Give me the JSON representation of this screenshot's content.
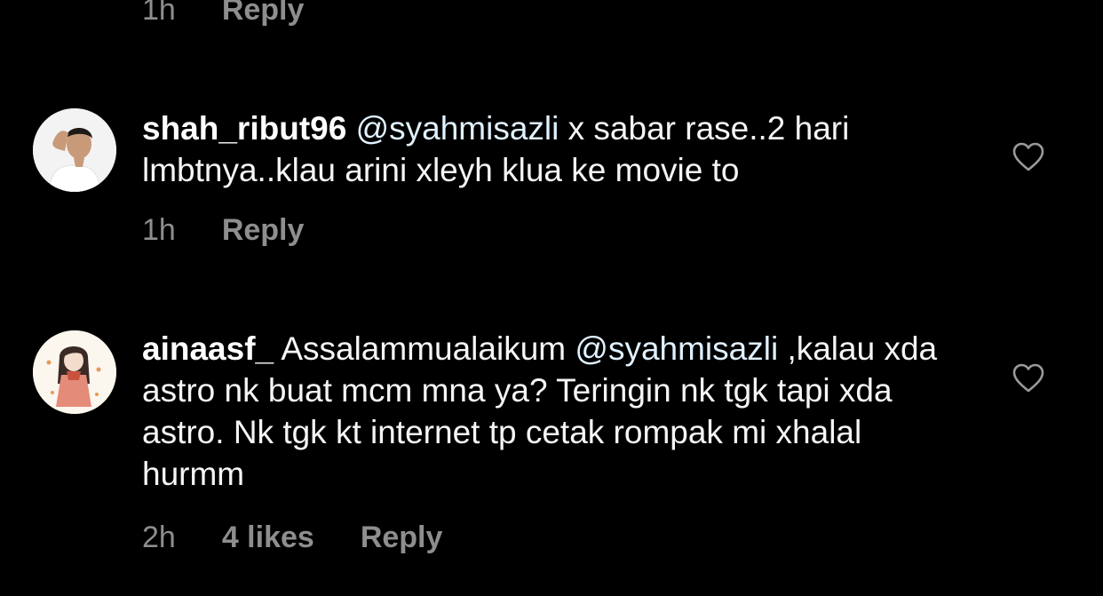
{
  "top_meta": {
    "time": "1h",
    "reply_label": "Reply"
  },
  "comments": [
    {
      "username": "shah_ribut96",
      "mention": "@syahmisazli",
      "text": " x sabar rase..2 hari lmbtnya..klau arini xleyh klua ke movie to",
      "time": "1h",
      "likes": "",
      "reply_label": "Reply",
      "like_icon": "heart-outline-icon"
    },
    {
      "username": "ainaasf_",
      "pre_text": " Assalammualaikum ",
      "mention": "@syahmisazli",
      "text": " ,kalau xda astro nk buat mcm mna ya? Teringin nk tgk tapi xda astro. Nk tgk kt internet tp cetak rompak mi xhalal hurmm",
      "time": "2h",
      "likes": "4 likes",
      "reply_label": "Reply",
      "like_icon": "heart-outline-icon"
    }
  ],
  "colors": {
    "background": "#000000",
    "secondary_text": "#8e8e8e",
    "primary_text": "#f5f5f5",
    "mention": "#e0f1ff"
  }
}
